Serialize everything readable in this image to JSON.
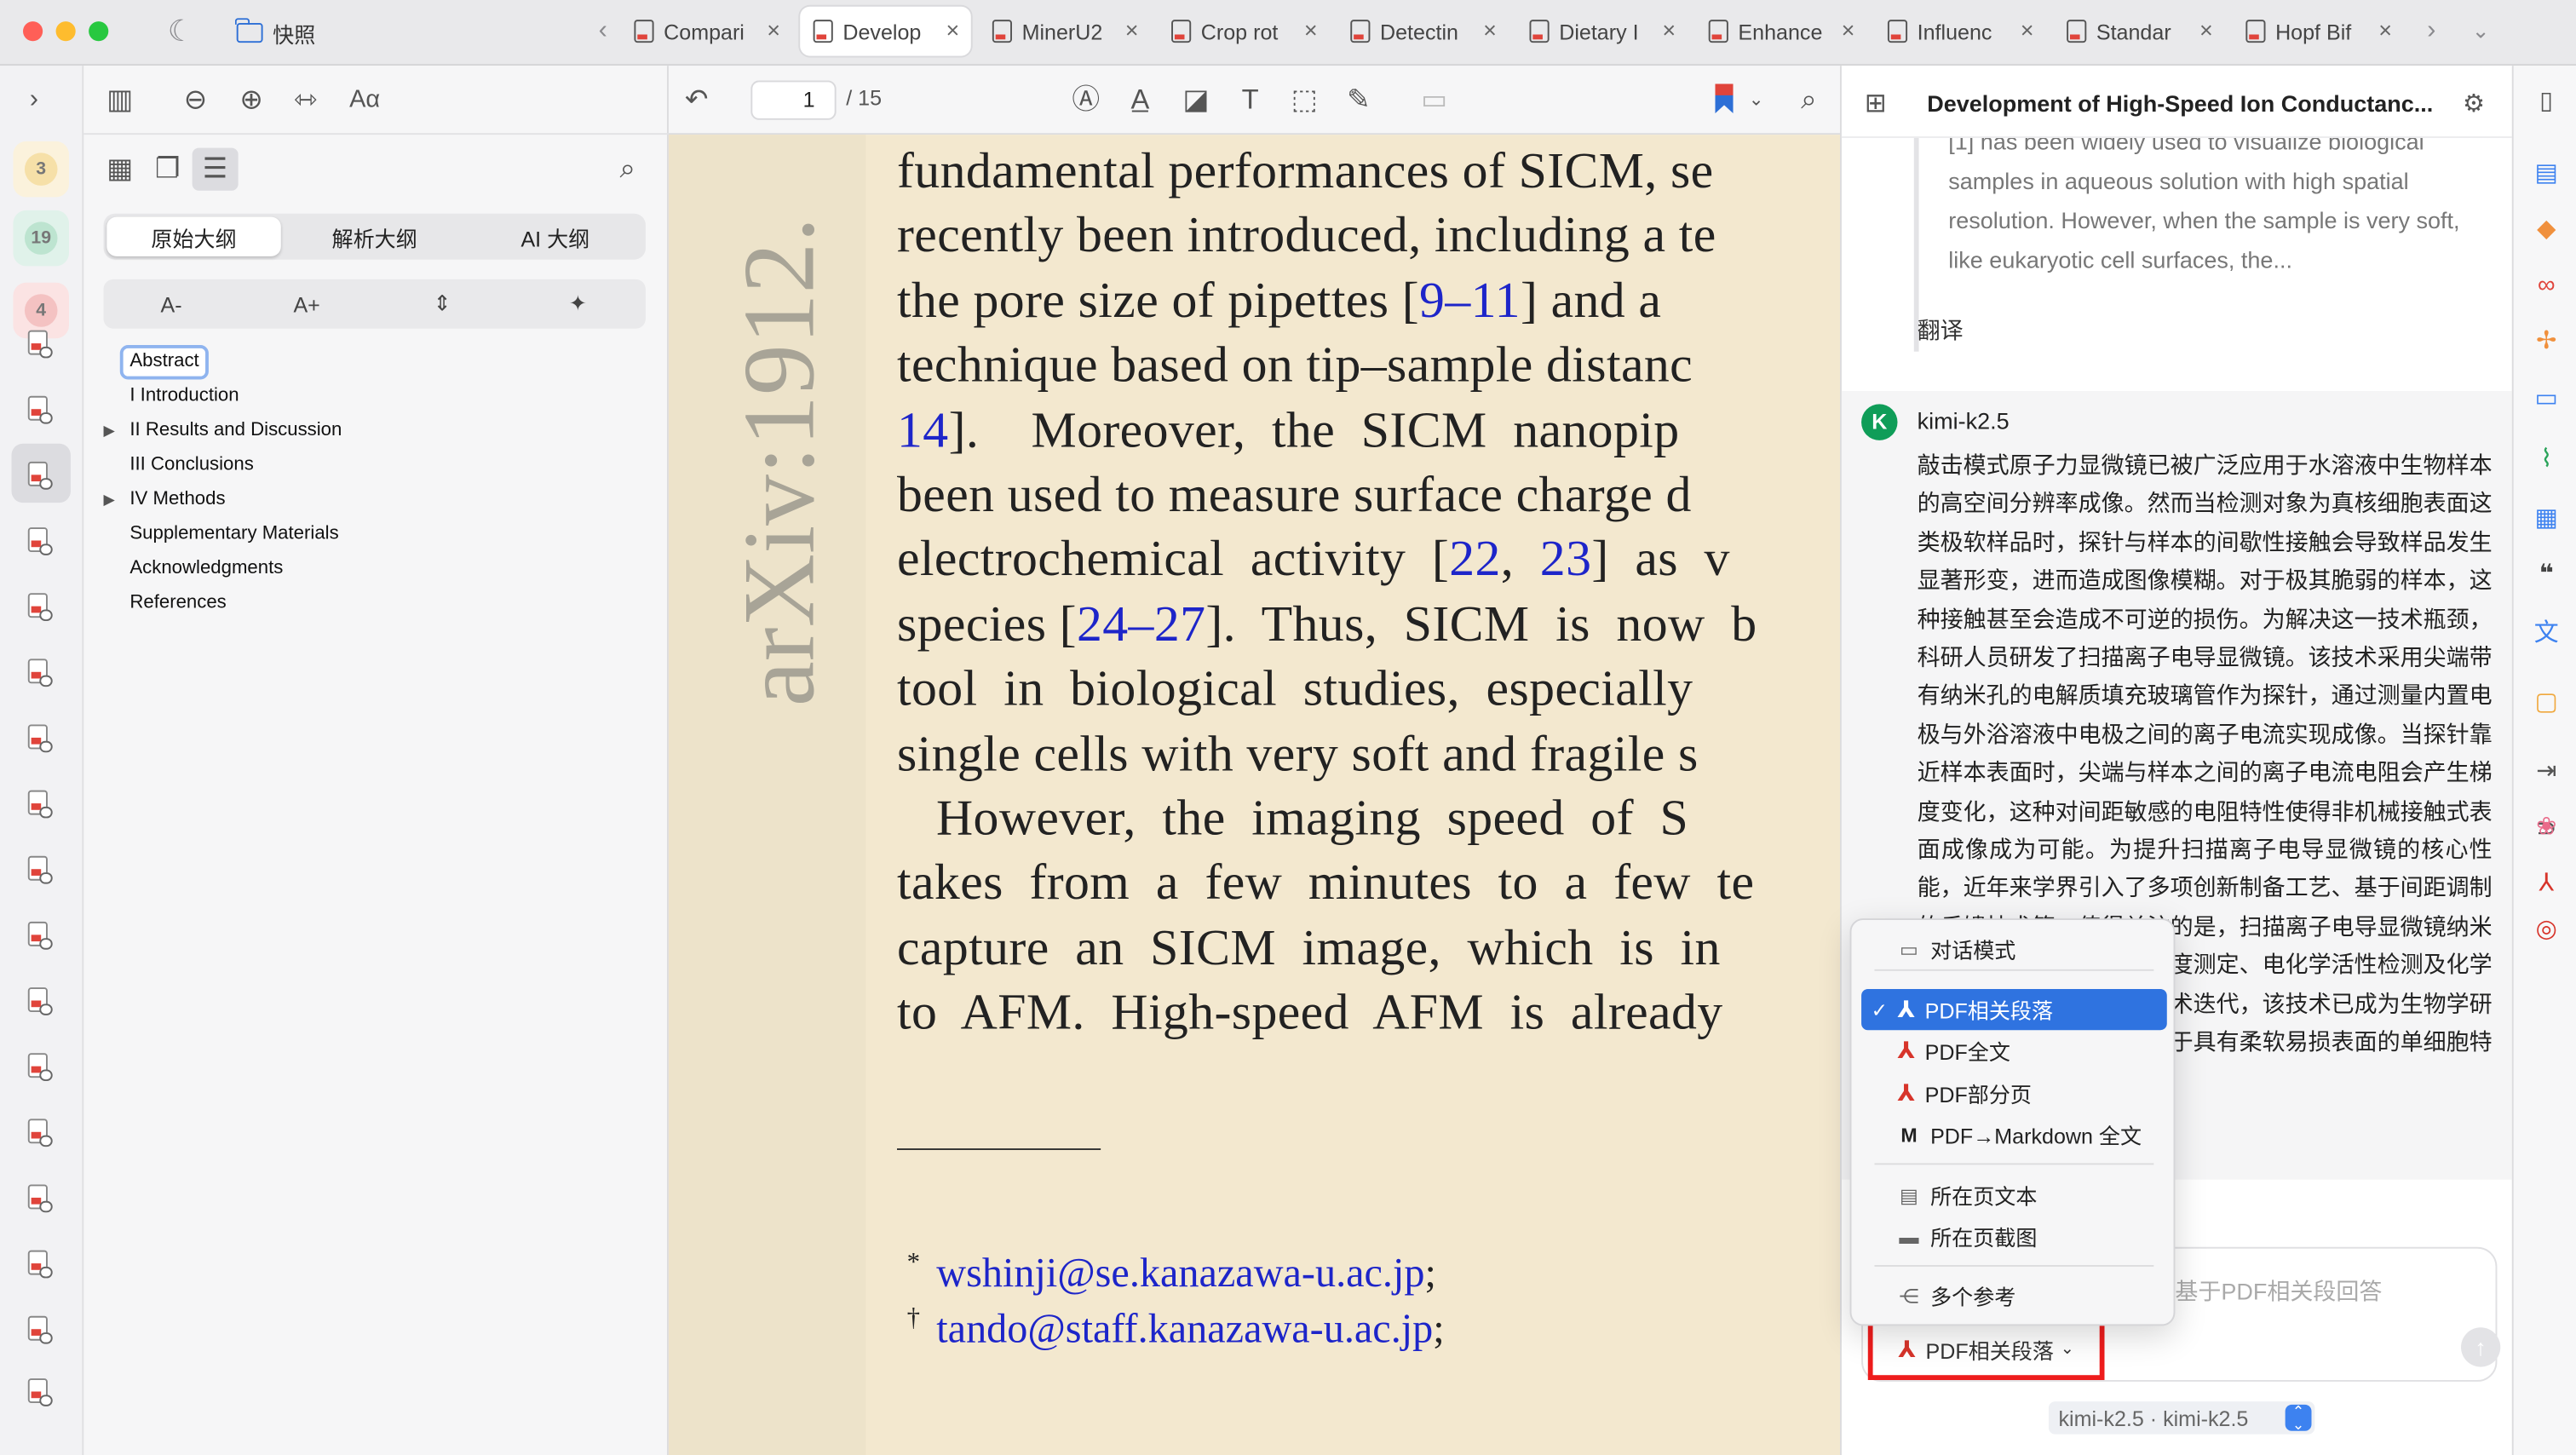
{
  "window": {
    "folder_label": "快照"
  },
  "tabs": [
    {
      "label": "Compari",
      "active": false
    },
    {
      "label": "Develop",
      "active": true
    },
    {
      "label": "MinerU2",
      "active": false
    },
    {
      "label": "Crop rot",
      "active": false
    },
    {
      "label": "Detectin",
      "active": false
    },
    {
      "label": "Dietary I",
      "active": false
    },
    {
      "label": "Enhance",
      "active": false
    },
    {
      "label": "Influenc",
      "active": false
    },
    {
      "label": "Standar",
      "active": false
    },
    {
      "label": "Hopf Bif",
      "active": false
    }
  ],
  "rail": {
    "badges": [
      "3",
      "19",
      "4"
    ]
  },
  "outline": {
    "tabs": [
      "原始大纲",
      "解析大纲",
      "AI 大纲"
    ],
    "font_controls": [
      "A-",
      "A+"
    ],
    "items": [
      {
        "label": "Abstract",
        "expandable": false,
        "selected": true
      },
      {
        "label": "I Introduction",
        "expandable": false,
        "selected": false
      },
      {
        "label": "II Results and Discussion",
        "expandable": true,
        "selected": false
      },
      {
        "label": "III Conclusions",
        "expandable": false,
        "selected": false
      },
      {
        "label": "IV Methods",
        "expandable": true,
        "selected": false
      },
      {
        "label": "Supplementary Materials",
        "expandable": false,
        "selected": false
      },
      {
        "label": "Acknowledgments",
        "expandable": false,
        "selected": false
      },
      {
        "label": "References",
        "expandable": false,
        "selected": false
      }
    ]
  },
  "toolbar": {
    "page_current": "1",
    "page_total": "/ 15"
  },
  "pdf": {
    "margin_watermark": "arXiv:1912.",
    "lines": [
      [
        {
          "t": "fundamental performances of SICM, se"
        }
      ],
      [
        {
          "t": "recently been introduced, including a te"
        }
      ],
      [
        {
          "t": "the pore size of pipettes ["
        },
        {
          "t": "9–11",
          "c": 1
        },
        {
          "t": "] and a"
        }
      ],
      [
        {
          "t": "technique based on tip–sample distanc"
        }
      ],
      [
        {
          "t": "14",
          "c": 1
        },
        {
          "t": "].    Moreover,  the  SICM  nanopip"
        }
      ],
      [
        {
          "t": "been used to measure surface charge d"
        }
      ],
      [
        {
          "t": "electrochemical  activity  ["
        },
        {
          "t": "22",
          "c": 1
        },
        {
          "t": ",  "
        },
        {
          "t": "23",
          "c": 1
        },
        {
          "t": "]  as  v"
        }
      ],
      [
        {
          "t": "species ["
        },
        {
          "t": "24–27",
          "c": 1
        },
        {
          "t": "].  Thus,  SICM  is  now  b"
        }
      ],
      [
        {
          "t": "tool  in  biological  studies,  especially"
        }
      ],
      [
        {
          "t": "single cells with very soft and fragile s"
        }
      ],
      [
        {
          "t": "   However,  the  imaging  speed  of  S"
        }
      ],
      [
        {
          "t": "takes  from  a  few  minutes  to  a  few  te"
        }
      ],
      [
        {
          "t": "capture  an  SICM  image,  which  is  in"
        }
      ],
      [
        {
          "t": "to  AFM.  High-speed  AFM  is  already"
        }
      ]
    ],
    "footnotes": [
      {
        "mark": "*",
        "email": "wshinji@se.kanazawa-u.ac.jp",
        "tail": ";"
      },
      {
        "mark": "†",
        "email": "tando@staff.kanazawa-u.ac.jp",
        "tail": ";"
      }
    ]
  },
  "ai": {
    "title": "Development of High-Speed Ion Conductanc...",
    "quote": "[1] has been widely used to visualize biological samples in aqueous solution with high spatial resolution. However, when the sample is very soft, like eukaryotic cell surfaces, the...",
    "translate_label": "翻译",
    "model_name": "kimi-k2.5",
    "reply": "敲击模式原子力显微镜已被广泛应用于水溶液中生物样本的高空间分辨率成像。然而当检测对象为真核细胞表面这类极软样品时，探针与样本的间歇性接触会导致样品发生显著形变，进而造成图像模糊。对于极其脆弱的样本，这种接触甚至会造成不可逆的损伤。为解决这一技术瓶颈，科研人员研发了扫描离子电导显微镜。该技术采用尖端带有纳米孔的电解质填充玻璃管作为探针，通过测量内置电极与外浴溶液中电极之间的离子电流实现成像。当探针靠近样本表面时，尖端与样本之间的离子电流电阻会产生梯度变化，这种对间距敏感的电阻特性使得非机械接触式表面成像成为可能。为提升扫描离子电导显微镜的核心性能，近年来学界引入了多项创新制备工艺、基于间距调制的反馈技术等。值得关注的是，扫描离子电导显微镜纳米探针还被用于表面电荷密度测定、电化学活性检测及化学物质递送等方向。随着技术迭代，该技术已成为生物学研究的重要工具，特别适用于具有柔软易损表面的单细胞特性解析。",
    "input_placeholder": "基于PDF相关段回答",
    "source_button": "PDF相关段落",
    "model_bar": "kimi-k2.5 · kimi-k2.5"
  },
  "menu": {
    "items": [
      {
        "label": "对话模式",
        "icon": "chat"
      },
      {
        "label": "PDF相关段落",
        "icon": "pdf",
        "selected": true
      },
      {
        "label": "PDF全文",
        "icon": "pdf"
      },
      {
        "label": "PDF部分页",
        "icon": "pdf"
      },
      {
        "label": "PDF→Markdown 全文",
        "icon": "markdown"
      },
      {
        "label": "所在页文本",
        "icon": "page-text"
      },
      {
        "label": "所在页截图",
        "icon": "page-image"
      },
      {
        "label": "多个参考",
        "icon": "share"
      }
    ]
  },
  "colors": {
    "accent": "#2f73e0",
    "highlight_border": "#ee1c1c",
    "pdf_bg": "#f3e8cf",
    "citation": "#1d25c9"
  }
}
